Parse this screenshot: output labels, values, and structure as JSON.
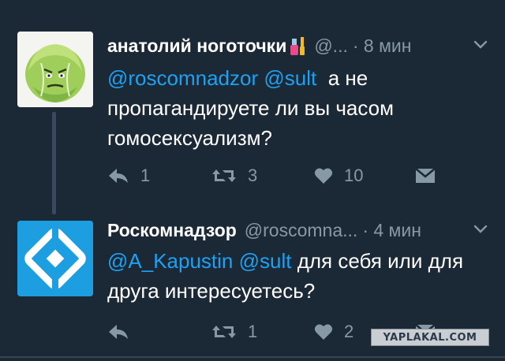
{
  "tweets": [
    {
      "name": "анатолий ноготочки",
      "handle": "@...",
      "time": "· 8 мин",
      "avatar_icon": "cabbage-avatar-icon",
      "text_parts": {
        "mention1": "@roscomnadzor",
        "mention2": "@sult",
        "body": "а не пропагандируете ли вы часом гомосексуализм?"
      },
      "actions": {
        "reply_count": "1",
        "retweet_count": "3",
        "like_count": "10"
      }
    },
    {
      "name": "Роскомнадзор",
      "handle": "@roscomna...",
      "time": "· 4 мин",
      "avatar_icon": "roskomnadzor-logo-icon",
      "text_parts": {
        "mention1": "@A_Kapustin",
        "mention2": "@sult",
        "body": "для себя или для друга интересуетесь?"
      },
      "actions": {
        "reply_count": "",
        "retweet_count": "1",
        "like_count": "2"
      }
    }
  ],
  "watermark": "YAPLAKAL.COM",
  "colors": {
    "background": "#1b2836",
    "mention": "#1da1f2",
    "muted": "#8899a6",
    "logo_blue": "#1d9ee0"
  }
}
